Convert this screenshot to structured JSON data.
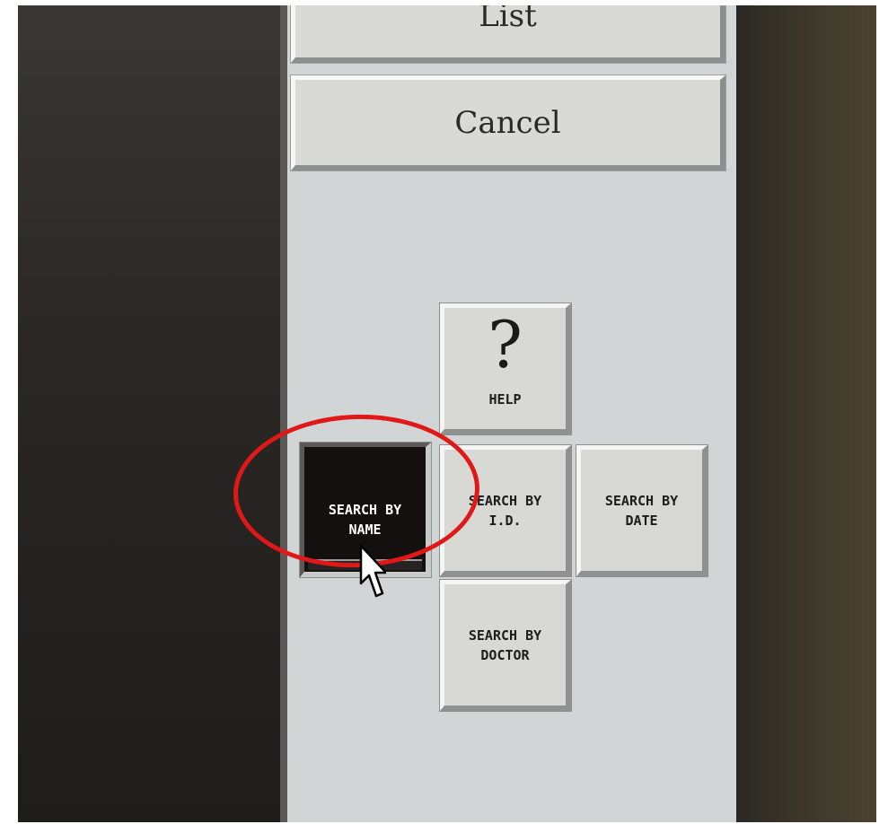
{
  "panel": {
    "list_button": "List",
    "cancel_button": "Cancel",
    "help_button": {
      "symbol": "?",
      "label": "HELP"
    },
    "search_by_name": {
      "line1": "SEARCH BY",
      "line2": "NAME",
      "selected": true
    },
    "search_by_id": {
      "line1": "SEARCH BY",
      "line2": "I.D."
    },
    "search_by_date": {
      "line1": "SEARCH BY",
      "line2": "DATE"
    },
    "search_by_doctor": {
      "line1": "SEARCH BY",
      "line2": "DOCTOR"
    }
  },
  "annotation": {
    "highlight_color": "#e01818",
    "cursor_icon": "arrow-cursor-icon"
  }
}
